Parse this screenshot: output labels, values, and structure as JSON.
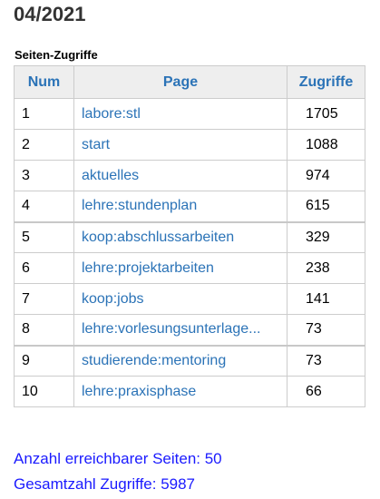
{
  "header": {
    "month": "04/2021",
    "section": "Seiten-Zugriffe"
  },
  "table": {
    "columns": [
      "Num",
      "Page",
      "Zugriffe"
    ],
    "rows": [
      {
        "num": "1",
        "page": "labore:stl",
        "hits": "1705"
      },
      {
        "num": "2",
        "page": "start",
        "hits": "1088"
      },
      {
        "num": "3",
        "page": "aktuelles",
        "hits": "974"
      },
      {
        "num": "4",
        "page": "lehre:stundenplan",
        "hits": "615"
      },
      {
        "num": "5",
        "page": "koop:abschlussarbeiten",
        "hits": "329"
      },
      {
        "num": "6",
        "page": "lehre:projektarbeiten",
        "hits": "238"
      },
      {
        "num": "7",
        "page": "koop:jobs",
        "hits": "141"
      },
      {
        "num": "8",
        "page": "lehre:vorlesungsunterlage...",
        "hits": "73"
      },
      {
        "num": "9",
        "page": "studierende:mentoring",
        "hits": "73"
      },
      {
        "num": "10",
        "page": "lehre:praxisphase",
        "hits": "66"
      }
    ]
  },
  "summary": {
    "reachable_pages": "Anzahl erreichbarer Seiten: 50",
    "total_hits": "Gesamtzahl Zugriffe: 5987"
  },
  "colors": {
    "link": "#2b73b7",
    "header_bg": "#eeeeee",
    "summary_text": "#1a1aff"
  }
}
